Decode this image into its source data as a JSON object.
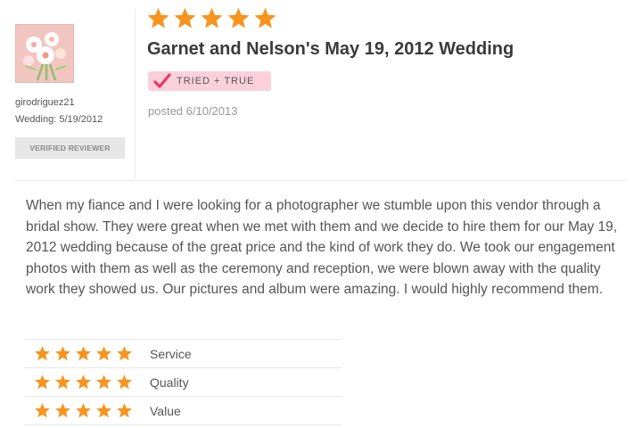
{
  "reviewer": {
    "avatar_icon": "bouquet-avatar-icon",
    "username": "girodriguez21",
    "wedding": "Wedding: 5/19/2012",
    "badge": "VERIFIED REVIEWER"
  },
  "review": {
    "rating": 5,
    "rating_max": 5,
    "star_color": "#f7941d",
    "title": "Garnet and Nelson's May 19, 2012 Wedding",
    "badge": {
      "label": "TRIED + TRUE",
      "icon": "checkmark-icon",
      "color": "#fbd0db",
      "check_color": "#e8386d"
    },
    "posted": "posted 6/10/2013",
    "body": "When my fiance and I were looking for a photographer we stumble upon this vendor through a bridal show. They were great when we met with them and we decide to hire them for our May 19, 2012 wedding because of the great price and the kind of work they do. We took our engagement photos with them as well as the ceremony and reception, we were blown away with the quality work they showed us. Our pictures and album were amazing. I would highly recommend them."
  },
  "ratings": [
    {
      "label": "Service",
      "stars": 5
    },
    {
      "label": "Quality",
      "stars": 5
    },
    {
      "label": "Value",
      "stars": 5
    }
  ]
}
